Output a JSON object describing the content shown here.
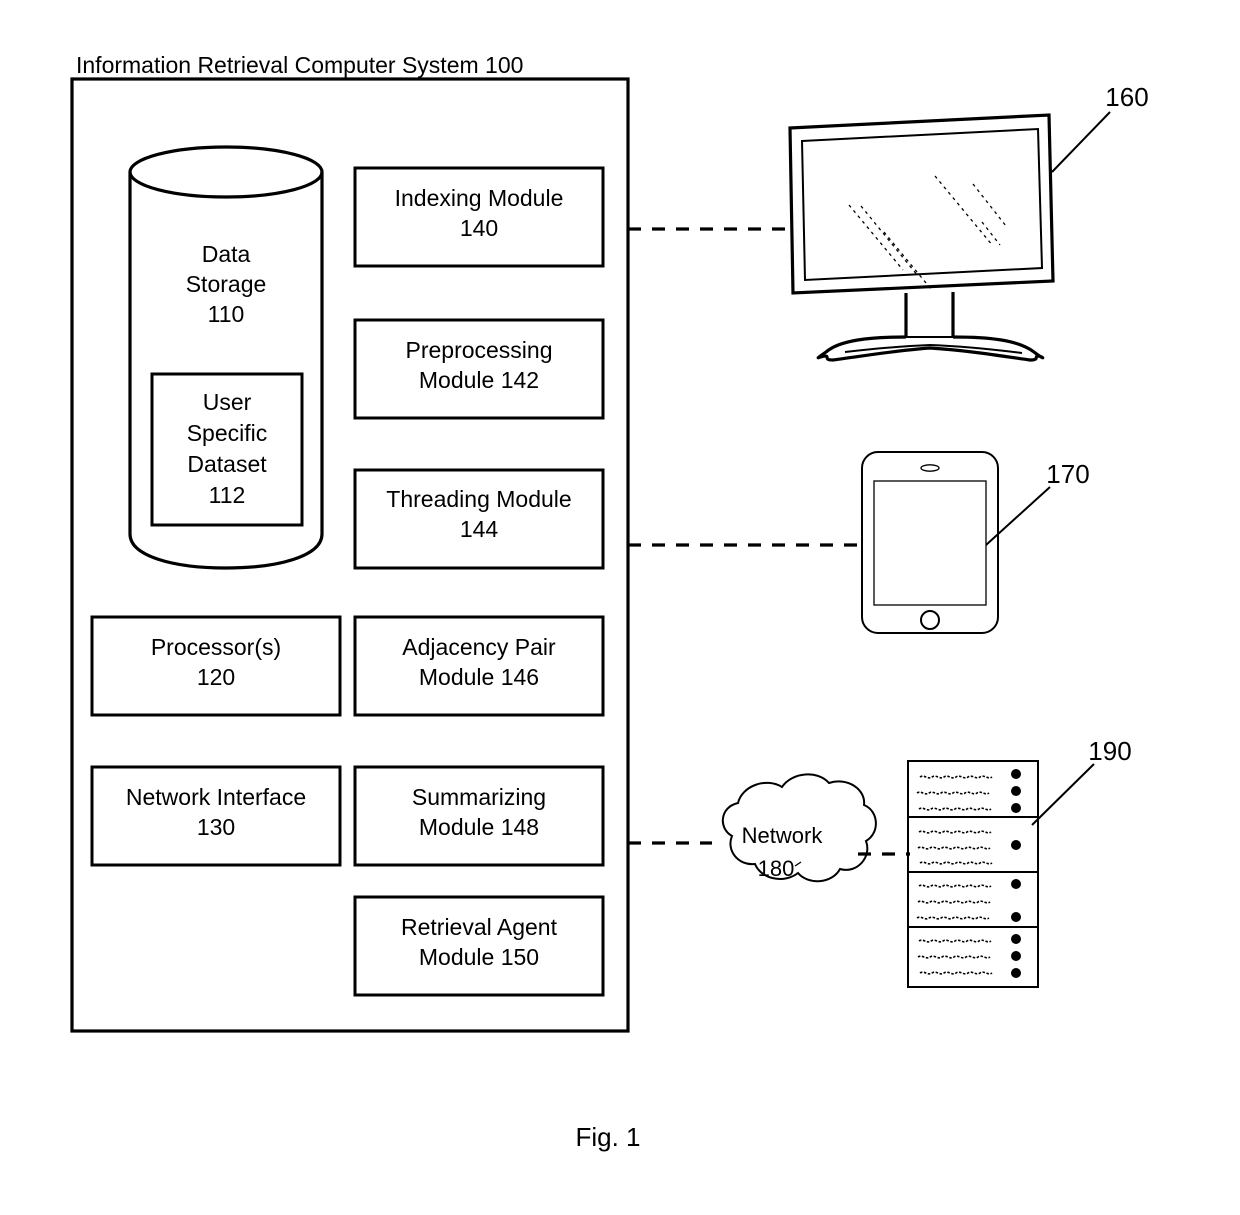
{
  "figure": {
    "caption": "Fig. 1",
    "system_title": "Information Retrieval Computer System 100"
  },
  "system_box": {
    "storage": {
      "line1": "Data",
      "line2": "Storage",
      "line3": "110",
      "inner": {
        "line1": "User",
        "line2": "Specific",
        "line3": "Dataset",
        "line4": "112"
      }
    },
    "left_boxes": [
      {
        "line1": "Processor(s)",
        "line2": "120"
      },
      {
        "line1": "Network Interface",
        "line2": "130"
      }
    ],
    "right_boxes": [
      {
        "line1": "Indexing Module",
        "line2": "140"
      },
      {
        "line1": "Preprocessing",
        "line2": "Module 142"
      },
      {
        "line1": "Threading Module",
        "line2": "144"
      },
      {
        "line1": "Adjacency Pair",
        "line2": "Module 146"
      },
      {
        "line1": "Summarizing",
        "line2": "Module 148"
      },
      {
        "line1": "Retrieval Agent",
        "line2": "Module 150"
      }
    ]
  },
  "external": {
    "monitor": {
      "ref": "160"
    },
    "tablet": {
      "ref": "170"
    },
    "network_cloud": {
      "line1": "Network",
      "line2": "180"
    },
    "server": {
      "ref": "190"
    }
  },
  "colors": {
    "ink": "#000000",
    "paper": "#ffffff"
  }
}
